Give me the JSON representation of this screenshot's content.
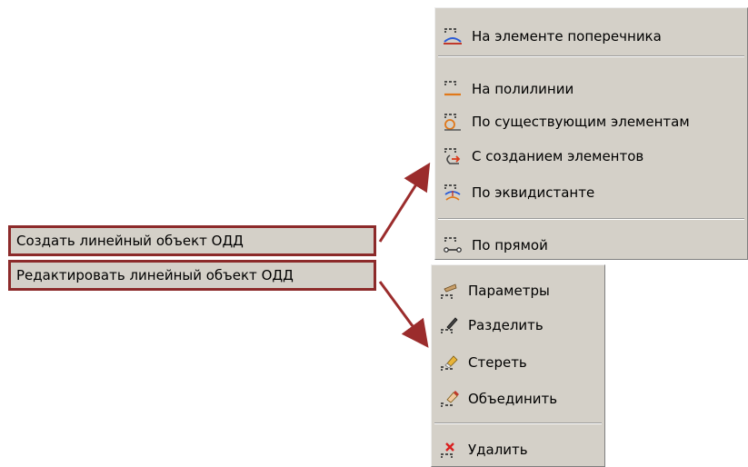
{
  "main_menu": {
    "create_label": "Создать линейный объект ОДД",
    "edit_label": "Редактировать линейный объект ОДД"
  },
  "create_submenu": {
    "items": [
      {
        "label": "На элементе поперечника",
        "icon": "cross-element-icon"
      },
      {
        "label": "На полилинии",
        "icon": "polyline-icon"
      },
      {
        "label": "По существующим элементам",
        "icon": "existing-elements-icon"
      },
      {
        "label": "С созданием элементов",
        "icon": "create-elements-icon"
      },
      {
        "label": "По эквидистанте",
        "icon": "equidistant-icon"
      },
      {
        "label": "По прямой",
        "icon": "straight-line-icon"
      }
    ]
  },
  "edit_submenu": {
    "items": [
      {
        "label": "Параметры",
        "icon": "parameters-icon"
      },
      {
        "label": "Разделить",
        "icon": "split-icon"
      },
      {
        "label": "Стереть",
        "icon": "erase-icon"
      },
      {
        "label": "Объединить",
        "icon": "merge-icon"
      },
      {
        "label": "Удалить",
        "icon": "delete-icon"
      }
    ]
  },
  "colors": {
    "menu_bg": "#d4d0c8",
    "highlight_border": "#8c2a2a",
    "arrow": "#9b2c2c"
  }
}
